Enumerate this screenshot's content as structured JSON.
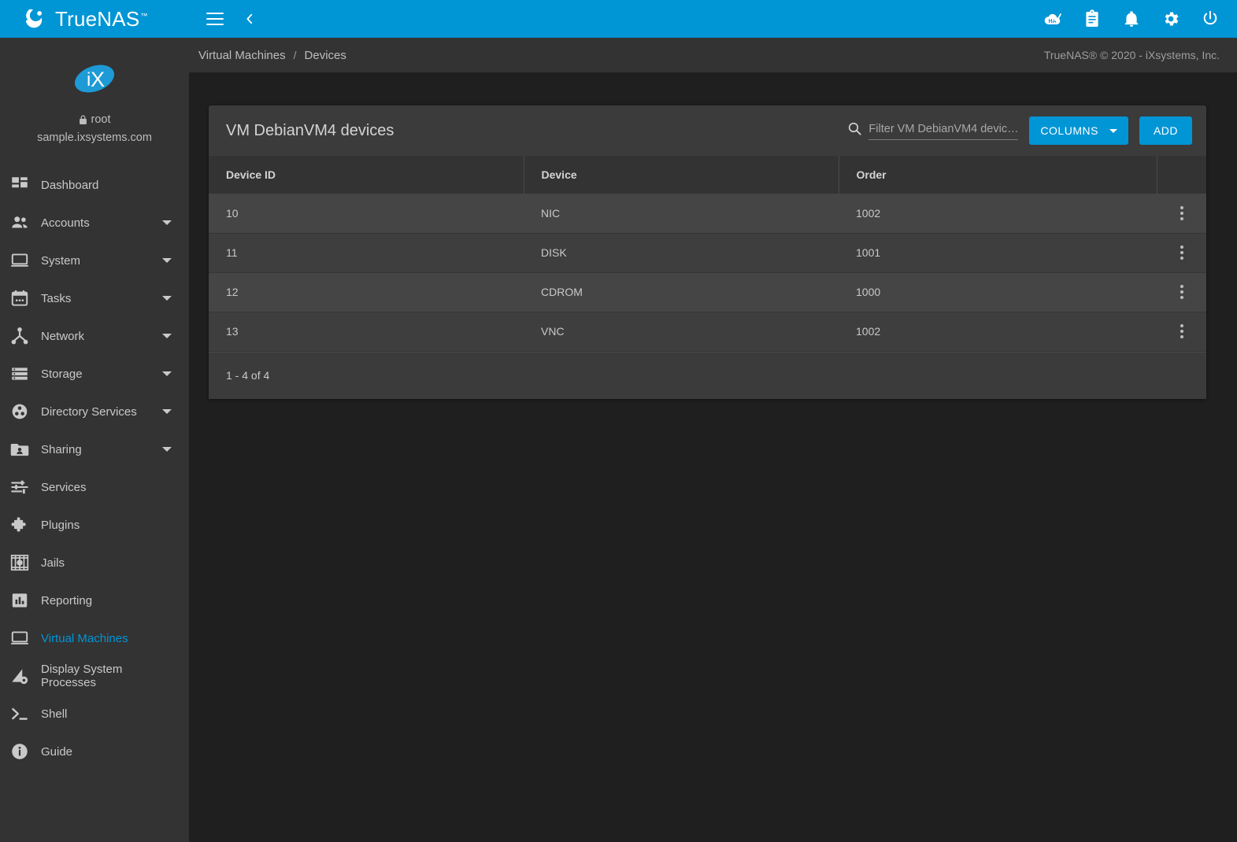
{
  "brand": {
    "name": "TrueNAS",
    "tm": "™",
    "logo_icon": "truenas-wave-logo"
  },
  "topbar": {
    "menu_icon": "hamburger-menu-icon",
    "back_icon": "chevron-left-icon",
    "icons": [
      {
        "name": "ha-status-icon",
        "label": "HA"
      },
      {
        "name": "task-manager-icon",
        "label": "Tasks"
      },
      {
        "name": "notifications-bell-icon",
        "label": "Alerts"
      },
      {
        "name": "settings-gear-icon",
        "label": "Settings"
      },
      {
        "name": "power-icon",
        "label": "Power"
      }
    ]
  },
  "sidebar": {
    "logo_icon": "ix-systems-logo",
    "lock_icon": "lock-icon",
    "username": "root",
    "hostname": "sample.ixsystems.com",
    "items": [
      {
        "label": "Dashboard",
        "icon": "dashboard-icon",
        "expandable": false,
        "active": false
      },
      {
        "label": "Accounts",
        "icon": "accounts-people-icon",
        "expandable": true,
        "active": false
      },
      {
        "label": "System",
        "icon": "system-laptop-icon",
        "expandable": true,
        "active": false
      },
      {
        "label": "Tasks",
        "icon": "tasks-calendar-icon",
        "expandable": true,
        "active": false
      },
      {
        "label": "Network",
        "icon": "network-nodes-icon",
        "expandable": true,
        "active": false
      },
      {
        "label": "Storage",
        "icon": "storage-stack-icon",
        "expandable": true,
        "active": false
      },
      {
        "label": "Directory Services",
        "icon": "directory-services-icon",
        "expandable": true,
        "active": false
      },
      {
        "label": "Sharing",
        "icon": "sharing-folder-icon",
        "expandable": true,
        "active": false
      },
      {
        "label": "Services",
        "icon": "services-sliders-icon",
        "expandable": false,
        "active": false
      },
      {
        "label": "Plugins",
        "icon": "plugins-puzzle-icon",
        "expandable": false,
        "active": false
      },
      {
        "label": "Jails",
        "icon": "jails-icon",
        "expandable": false,
        "active": false
      },
      {
        "label": "Reporting",
        "icon": "reporting-chart-icon",
        "expandable": false,
        "active": false
      },
      {
        "label": "Virtual Machines",
        "icon": "virtual-machines-icon",
        "expandable": false,
        "active": true
      },
      {
        "label": "Display System Processes",
        "icon": "system-processes-icon",
        "expandable": false,
        "active": false
      },
      {
        "label": "Shell",
        "icon": "shell-prompt-icon",
        "expandable": false,
        "active": false
      },
      {
        "label": "Guide",
        "icon": "guide-info-icon",
        "expandable": false,
        "active": false
      }
    ]
  },
  "breadcrumb": {
    "items": [
      "Virtual Machines",
      "Devices"
    ],
    "separator": "/"
  },
  "copyright": "TrueNAS® © 2020 - iXsystems, Inc.",
  "card": {
    "title": "VM DebianVM4 devices",
    "search": {
      "placeholder": "Filter VM DebianVM4 devic…",
      "value": "",
      "icon": "search-icon"
    },
    "columns_button": "COLUMNS",
    "add_button": "ADD",
    "table": {
      "headers": [
        "Device ID",
        "Device",
        "Order",
        ""
      ],
      "rows": [
        {
          "device_id": "10",
          "device": "NIC",
          "order": "1002"
        },
        {
          "device_id": "11",
          "device": "DISK",
          "order": "1001"
        },
        {
          "device_id": "12",
          "device": "CDROM",
          "order": "1000"
        },
        {
          "device_id": "13",
          "device": "VNC",
          "order": "1002"
        }
      ]
    },
    "pagination": "1 - 4 of 4"
  },
  "colors": {
    "accent": "#0095d5",
    "page_bg": "#1f1f1f",
    "card_bg": "#3b3b3b",
    "sidebar_bg": "#333333"
  }
}
